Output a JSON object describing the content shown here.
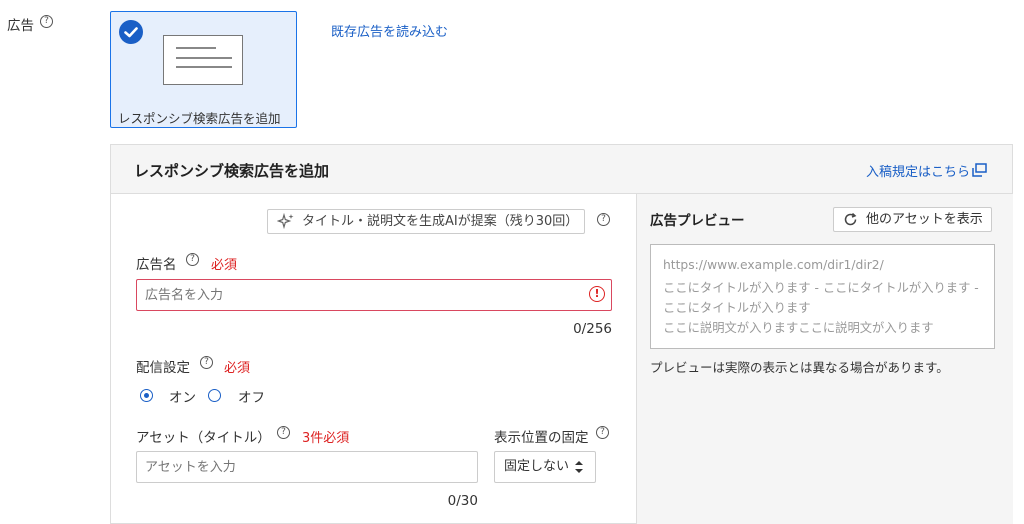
{
  "field_label": "広告",
  "help_glyph": "?",
  "ad_type_card": {
    "label": "レスポンシブ検索広告を追加",
    "selected": true
  },
  "load_existing_link": "既存広告を読み込む",
  "panel": {
    "title": "レスポンシブ検索広告を追加",
    "guidelines_link": "入稿規定はこちら"
  },
  "ai_suggest_button": "タイトル・説明文を生成AIが提案（残り30回）",
  "ad_name": {
    "label": "広告名",
    "required": "必須",
    "placeholder": "広告名を入力",
    "counter": "0/256",
    "error_glyph": "!"
  },
  "delivery": {
    "label": "配信設定",
    "required": "必須",
    "options": [
      {
        "label": "オン",
        "checked": true
      },
      {
        "label": "オフ",
        "checked": false
      }
    ]
  },
  "asset_title": {
    "label": "アセット（タイトル）",
    "required": "3件必須",
    "placeholder": "アセットを入力",
    "counter": "0/30"
  },
  "pin": {
    "label": "表示位置の固定",
    "selected": "固定しない"
  },
  "preview": {
    "title": "広告プレビュー",
    "other_assets_button": "他のアセットを表示",
    "lines": [
      "https://www.example.com/dir1/dir2/",
      "ここにタイトルが入ります - ここにタイトルが入ります -",
      "ここにタイトルが入ります",
      "ここに説明文が入りますここに説明文が入ります"
    ],
    "note": "プレビューは実際の表示とは異なる場合があります。"
  },
  "colors": {
    "accent": "#1a5fc6",
    "required": "#dd2222",
    "error_border": "#d9485f"
  }
}
